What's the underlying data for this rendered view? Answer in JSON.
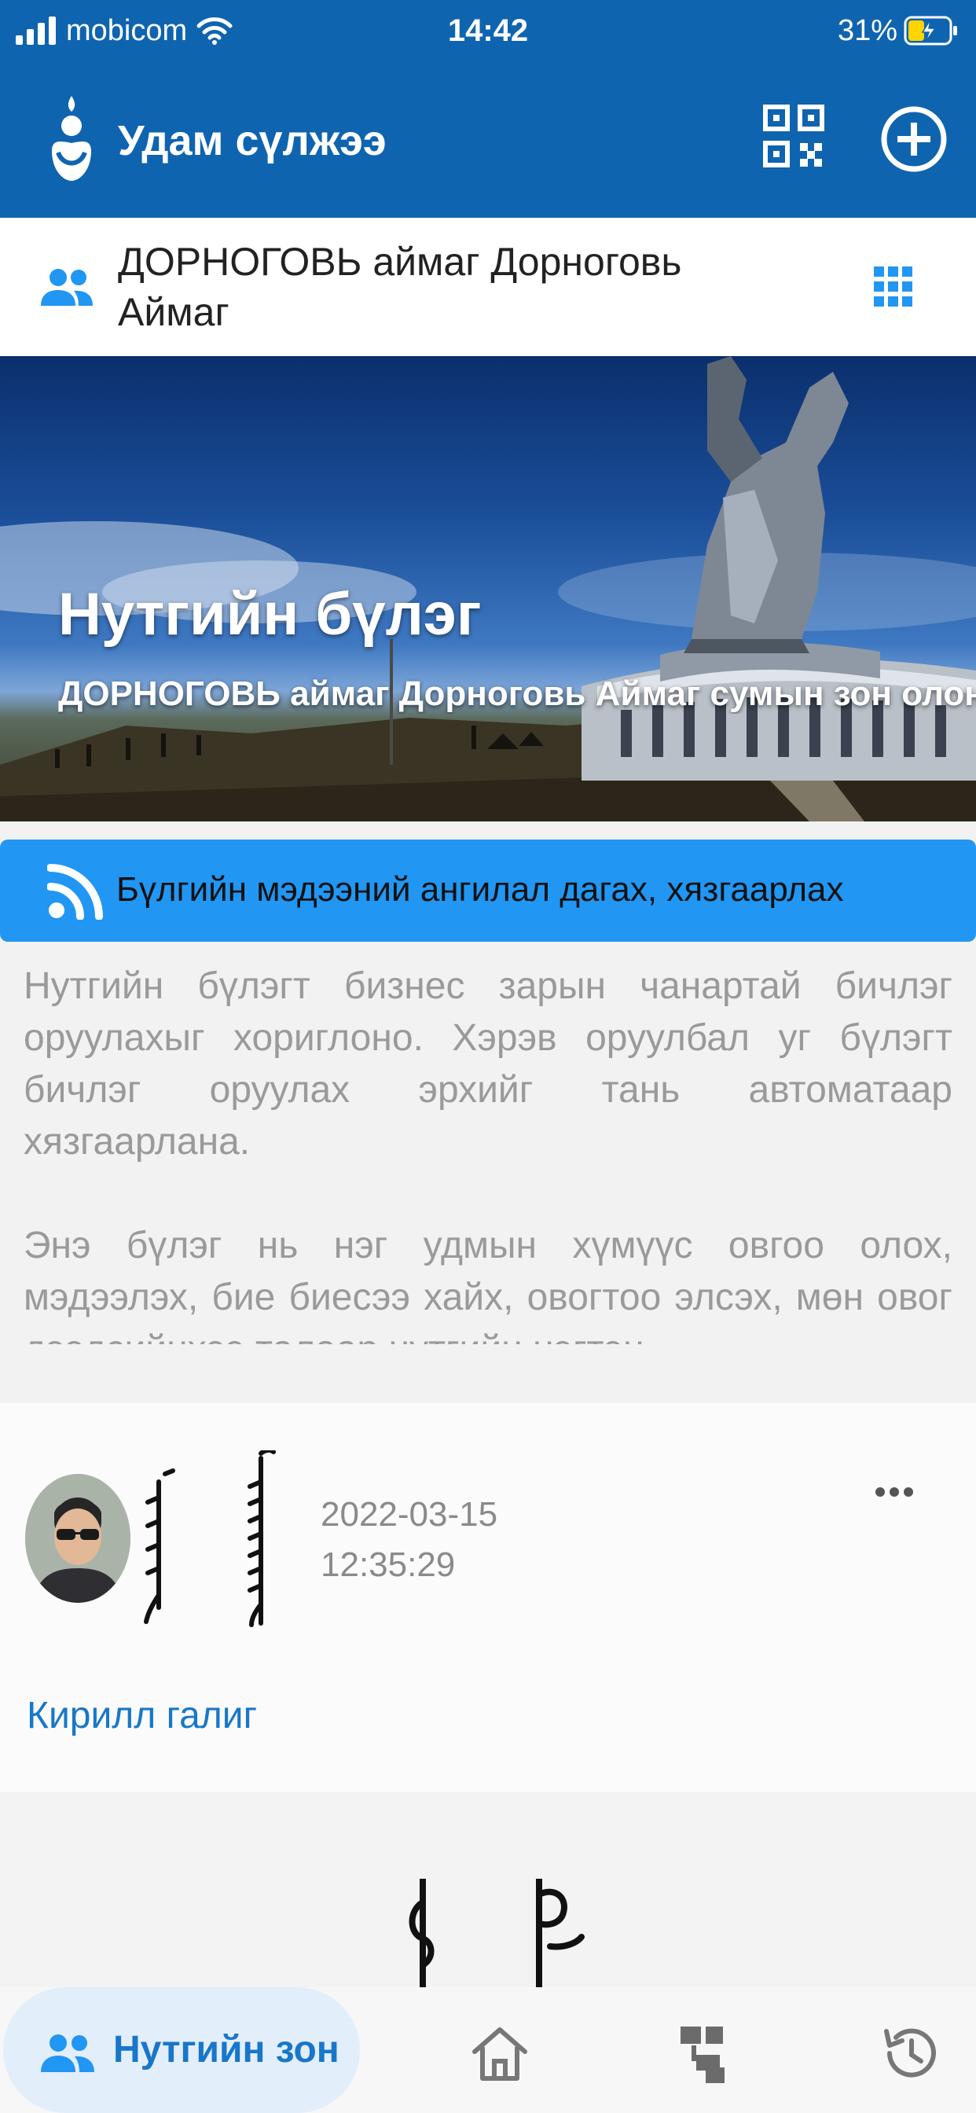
{
  "status_bar": {
    "carrier": "mobicom",
    "time": "14:42",
    "battery": "31%",
    "icons": [
      "signal-icon",
      "wifi-icon",
      "battery-charging-icon"
    ]
  },
  "app_bar": {
    "title": "Удам сүлжээ",
    "icons": [
      "app-logo-icon",
      "qr-code-icon",
      "add-circle-icon"
    ]
  },
  "group": {
    "name": "ДОРНОГОВЬ аймаг Дорноговь Аймаг",
    "icons": [
      "people-icon",
      "grid-icon"
    ]
  },
  "hero": {
    "title": "Нутгийн бүлэг",
    "subtitle": "ДОРНОГОВЬ аймаг Дорноговь Аймаг сумын зон олон"
  },
  "subscribe": {
    "label": "Бүлгийн мэдээний ангилал дагах, хязгаарлах",
    "icon": "rss-icon"
  },
  "rules": {
    "paragraph_1": "Нутгийн бүлэгт бизнес зарын чанартай бичлэг оруулахыг хориглоно. Хэрэв оруулбал уг бүлэгт бичлэг оруулах эрхийг тань автоматаар хязгаарлана.",
    "paragraph_2": "Энэ бүлэг нь нэг удмын хүмүүс овгоо олох, мэдээлэх, бие биесээ хайх, овогтоо элсэх, мөн овог дээдсийнхээ талаар нутгийн нэгтэн"
  },
  "post": {
    "date": "2022-03-15",
    "time": "12:35:29",
    "transliteration_link": "Кирилл галиг",
    "icons": [
      "more-horizontal-icon",
      "avatar"
    ]
  },
  "bottom_nav": {
    "active_label": "Нутгийн зон",
    "items": [
      "people-icon",
      "home-icon",
      "tree-icon",
      "history-icon"
    ]
  },
  "colors": {
    "primary": "#0f64b0",
    "accent": "#2196f3",
    "link": "#1877c9"
  }
}
